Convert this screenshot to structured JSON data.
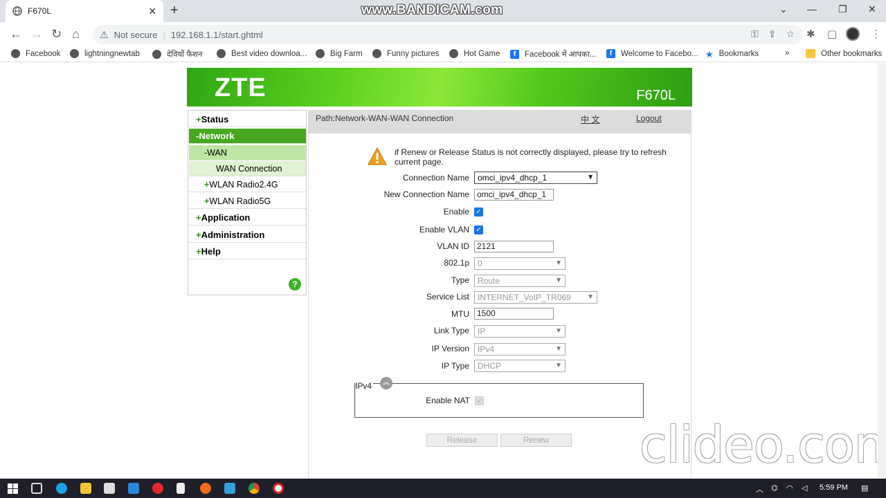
{
  "browser": {
    "tab_title": "F670L",
    "recorder_watermark": "www.BANDICAM.com",
    "security_label": "Not secure",
    "url": "192.168.1.1/start.ghtml",
    "bookmarks": [
      "Facebook",
      "lightningnewtab",
      "देवियों फैशन",
      "Best video downloa...",
      "Big Farm",
      "Funny pictures",
      "Hot Game",
      "Facebook में आपका...",
      "Welcome to Facebo...",
      "Bookmarks",
      "»",
      "Other bookmarks"
    ]
  },
  "router": {
    "brand": "ZTE",
    "model": "F670L",
    "menu": {
      "status": "Status",
      "network": "Network",
      "wan": "WAN",
      "wan_connection": "WAN Connection",
      "wlan24": "WLAN Radio2.4G",
      "wlan5": "WLAN Radio5G",
      "application": "Application",
      "administration": "Administration",
      "help": "Help",
      "plus": "+",
      "minus": "-",
      "help_icon": "?"
    },
    "path": "Path:Network-WAN-WAN Connection",
    "language": "中 文",
    "logout": "Logout",
    "notice": "if Renew or Release Status is not correctly displayed, please try to refresh current page.",
    "form": {
      "connection_name_label": "Connection Name",
      "connection_name_value": "omci_ipv4_dhcp_1",
      "new_connection_name_label": "New Connection Name",
      "new_connection_name_value": "omci_ipv4_dhcp_1",
      "enable_label": "Enable",
      "enable_vlan_label": "Enable VLAN",
      "vlan_id_label": "VLAN ID",
      "vlan_id_value": "2121",
      "p8021_label": "802.1p",
      "p8021_value": "0",
      "type_label": "Type",
      "type_value": "Route",
      "service_list_label": "Service List",
      "service_list_value": "INTERNET_VoIP_TR069",
      "mtu_label": "MTU",
      "mtu_value": "1500",
      "link_type_label": "Link Type",
      "link_type_value": "IP",
      "ip_version_label": "IP Version",
      "ip_version_value": "IPv4",
      "ip_type_label": "IP Type",
      "ip_type_value": "DHCP"
    },
    "ipv4_section": {
      "title": "IPv4",
      "enable_nat_label": "Enable NAT"
    },
    "buttons": {
      "release": "Release",
      "renew": "Renew"
    }
  },
  "editor_watermark": "clideo.com",
  "taskbar": {
    "time": "5:59 PM"
  }
}
